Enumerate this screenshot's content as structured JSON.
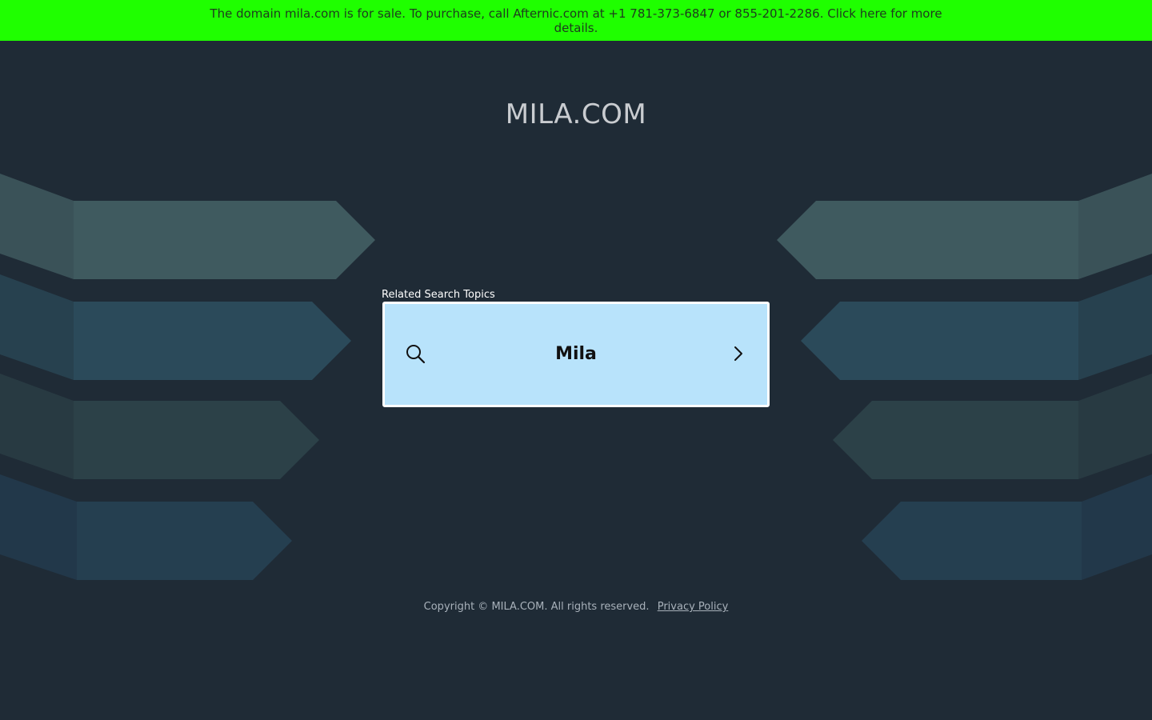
{
  "banner": {
    "text": "The domain mila.com is for sale. To purchase, call Afternic.com at +1 781-373-6847 or 855-201-2286. Click here for more details."
  },
  "header": {
    "title": "MILA.COM"
  },
  "related": {
    "label": "Related Search Topics",
    "items": [
      {
        "term": "Mila"
      }
    ]
  },
  "footer": {
    "copyright": "Copyright © MILA.COM.  All rights reserved.",
    "privacy_label": "Privacy Policy"
  },
  "icons": {
    "search": "search-icon",
    "chevron": "chevron-right-icon"
  },
  "colors": {
    "banner_bg": "#1fff00",
    "page_bg": "#1f2b36",
    "card_bg": "#b8e3fb"
  }
}
